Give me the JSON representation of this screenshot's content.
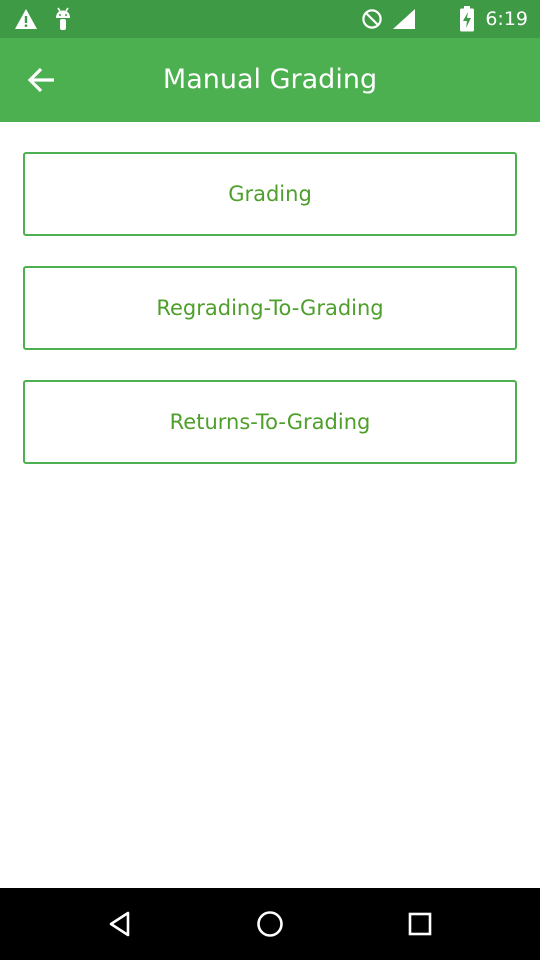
{
  "status_bar": {
    "time": "6:19",
    "left_icons": [
      "warning-icon",
      "android-debug-icon"
    ],
    "right_icons": [
      "do-not-disturb-icon",
      "battery-icon"
    ]
  },
  "app_bar": {
    "back_icon": "arrow-left-icon",
    "title": "Manual Grading"
  },
  "menu": {
    "items": [
      {
        "label": "Grading"
      },
      {
        "label": "Regrading-To-Grading"
      },
      {
        "label": "Returns-To-Grading"
      }
    ]
  },
  "nav_bar": {
    "buttons": [
      "back-triangle-icon",
      "home-circle-icon",
      "recents-square-icon"
    ]
  },
  "colors": {
    "status_bar": "#3f9a46",
    "app_bar": "#4caf50",
    "accent_text": "#4e9f2b",
    "button_border": "#4caf50"
  }
}
